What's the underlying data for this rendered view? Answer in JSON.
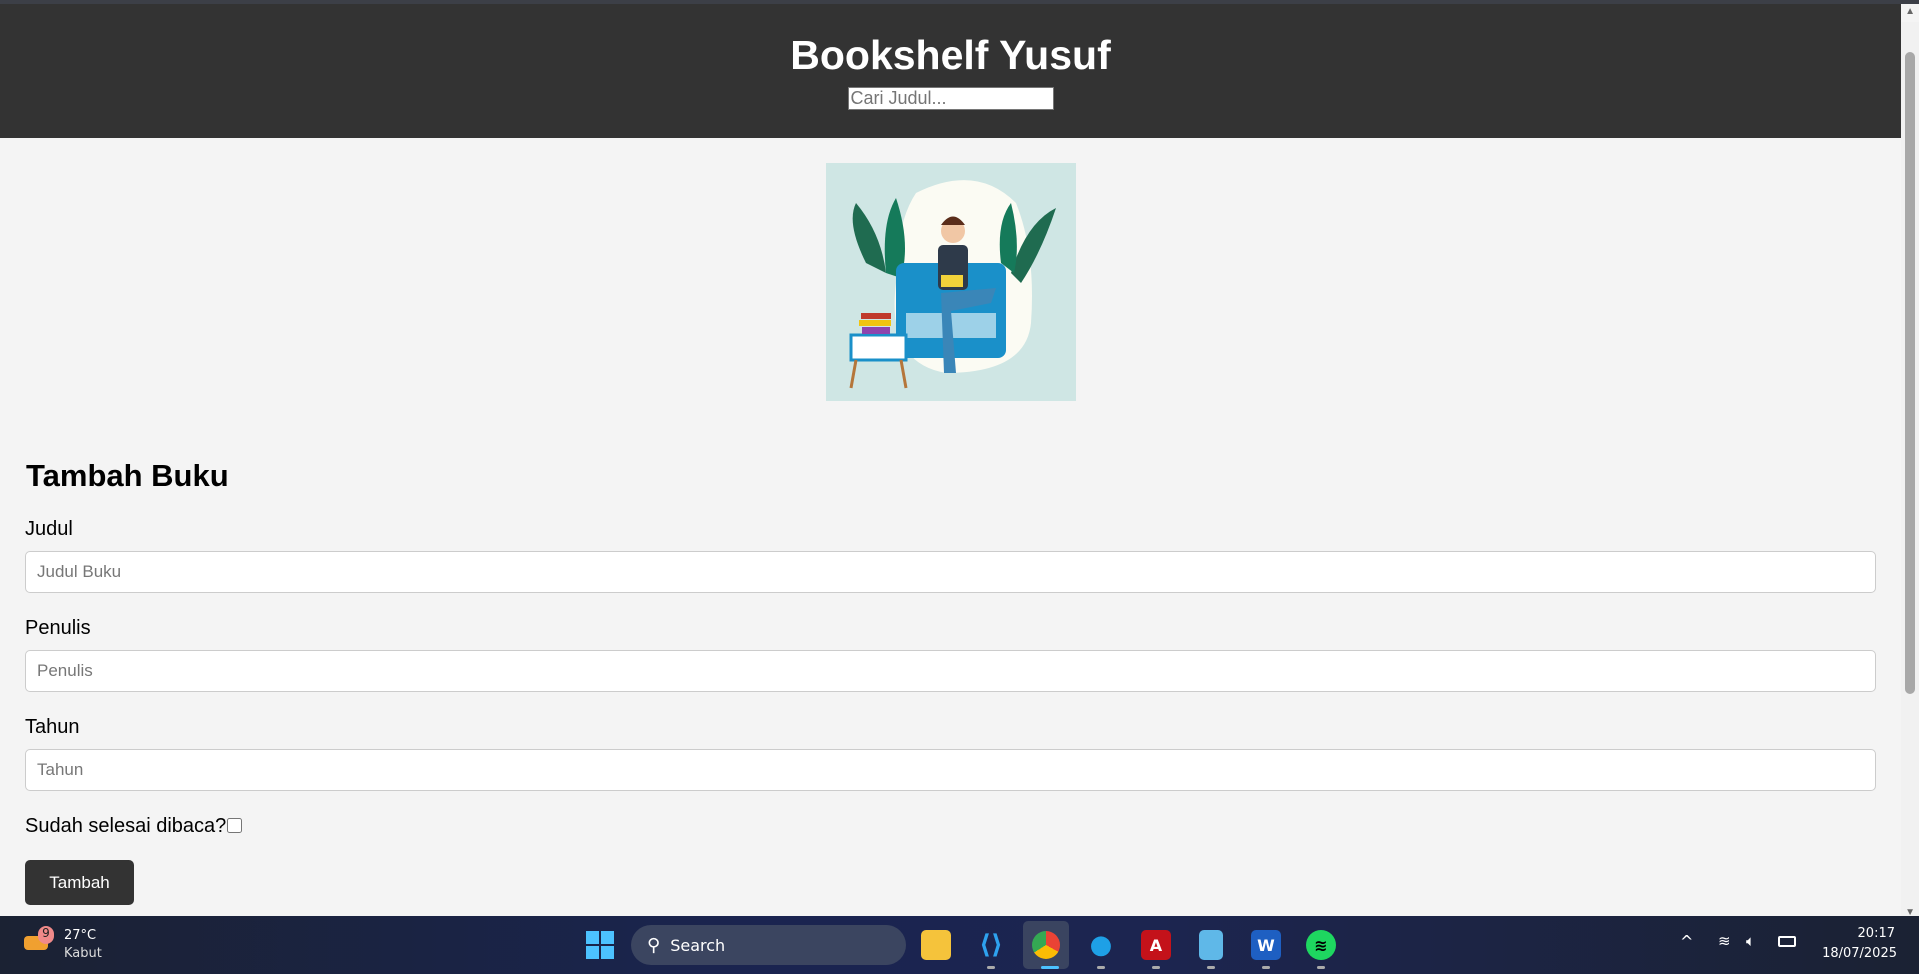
{
  "header": {
    "title": "Bookshelf Yusuf",
    "search_placeholder": "Cari Judul..."
  },
  "form": {
    "heading": "Tambah Buku",
    "title_label": "Judul",
    "title_placeholder": "Judul Buku",
    "author_label": "Penulis",
    "author_placeholder": "Penulis",
    "year_label": "Tahun",
    "year_placeholder": "Tahun",
    "complete_label": "Sudah selesai dibaca?",
    "complete_checked": false,
    "submit_label": "Tambah"
  },
  "taskbar": {
    "weather_temp": "27°C",
    "weather_desc": "Kabut",
    "weather_badge": "9",
    "search_label": "Search",
    "time": "20:17",
    "date": "18/07/2025"
  }
}
